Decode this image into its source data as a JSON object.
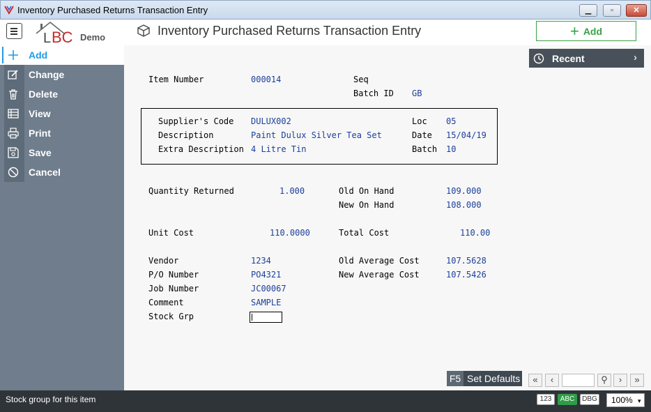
{
  "window": {
    "title": "Inventory Purchased Returns Transaction Entry",
    "min": "▭",
    "max": "□",
    "close": "✕"
  },
  "header": {
    "logo_text": "BC",
    "logo_demo": "Demo",
    "page_title": "Inventory Purchased Returns Transaction Entry",
    "add_label": "Add"
  },
  "sidebar": {
    "items": [
      {
        "label": "Add",
        "icon": "plus-icon"
      },
      {
        "label": "Change",
        "icon": "edit-icon"
      },
      {
        "label": "Delete",
        "icon": "trash-icon"
      },
      {
        "label": "View",
        "icon": "table-icon"
      },
      {
        "label": "Print",
        "icon": "printer-icon"
      },
      {
        "label": "Save",
        "icon": "save-icon"
      },
      {
        "label": "Cancel",
        "icon": "cancel-icon"
      }
    ]
  },
  "recent": {
    "label": "Recent",
    "chevron": "›"
  },
  "form": {
    "item_number": {
      "label": "Item Number",
      "value": "000014"
    },
    "seq": {
      "label": "Seq",
      "value": ""
    },
    "batch_id": {
      "label": "Batch ID",
      "value": "GB"
    },
    "suppliers_code": {
      "label": "Supplier's Code",
      "value": "DULUX002"
    },
    "loc": {
      "label": "Loc",
      "value": "05"
    },
    "description": {
      "label": "Description",
      "value": "Paint Dulux Silver Tea Set"
    },
    "date": {
      "label": "Date",
      "value": "15/04/19"
    },
    "extra_description": {
      "label": "Extra Description",
      "value": "4 Litre Tin"
    },
    "batch": {
      "label": "Batch",
      "value": "10"
    },
    "quantity_returned": {
      "label": "Quantity Returned",
      "value": "1.000"
    },
    "old_on_hand": {
      "label": "Old On Hand",
      "value": "109.000"
    },
    "new_on_hand": {
      "label": "New On Hand",
      "value": "108.000"
    },
    "unit_cost": {
      "label": "Unit Cost",
      "value": "110.0000"
    },
    "total_cost": {
      "label": "Total Cost",
      "value": "110.00"
    },
    "vendor": {
      "label": "Vendor",
      "value": "1234"
    },
    "old_average_cost": {
      "label": "Old Average Cost",
      "value": "107.5628"
    },
    "po_number": {
      "label": "P/O Number",
      "value": "PO4321"
    },
    "new_average_cost": {
      "label": "New Average Cost",
      "value": "107.5426"
    },
    "job_number": {
      "label": "Job Number",
      "value": "JC00067"
    },
    "comment": {
      "label": "Comment",
      "value": "SAMPLE"
    },
    "stock_grp": {
      "label": "Stock Grp",
      "value": ""
    }
  },
  "footer": {
    "set_defaults_key": "F5",
    "set_defaults_label": "Set Defaults",
    "nav": {
      "first": "«",
      "prev": "‹",
      "search": "⚲",
      "next": "›",
      "last": "»"
    },
    "status_message": "Stock group for this item",
    "badges": [
      "123",
      "ABC",
      "DBG"
    ],
    "active_badge": "ABC",
    "zoom": "100%"
  },
  "colors": {
    "accent_blue": "#1f9be3",
    "add_green": "#3aa047",
    "sidebar": "#6f7d8c",
    "value_blue": "#1b3f9a"
  }
}
